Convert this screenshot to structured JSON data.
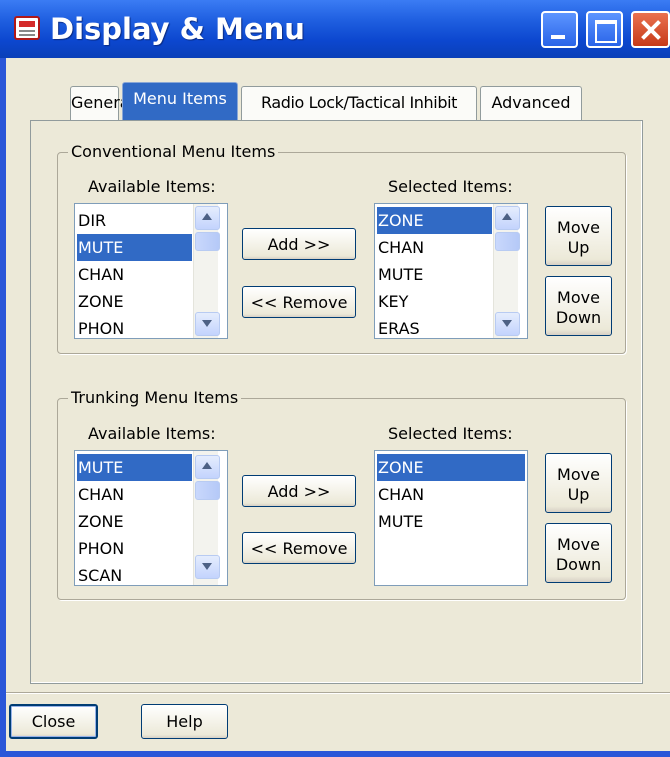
{
  "window": {
    "title": "Display & Menu"
  },
  "tabs": [
    "General",
    "Menu Items",
    "Radio Lock/Tactical Inhibit",
    "Advanced"
  ],
  "active_tab": "Menu Items",
  "conventional": {
    "group_label": "Conventional Menu Items",
    "available_label": "Available Items:",
    "selected_label": "Selected Items:",
    "available_items": [
      "DIR",
      "MUTE",
      "CHAN",
      "ZONE",
      "PHON"
    ],
    "available_selected": "MUTE",
    "selected_items": [
      "ZONE",
      "CHAN",
      "MUTE",
      "KEY",
      "ERAS"
    ],
    "selected_selected": "ZONE",
    "add_label": "Add >>",
    "remove_label": "<< Remove",
    "move_up": [
      "Move",
      "Up"
    ],
    "move_down": [
      "Move",
      "Down"
    ]
  },
  "trunking": {
    "group_label": "Trunking Menu Items",
    "available_label": "Available Items:",
    "selected_label": "Selected Items:",
    "available_items": [
      "MUTE",
      "CHAN",
      "ZONE",
      "PHON",
      "SCAN"
    ],
    "available_selected": "MUTE",
    "selected_items": [
      "ZONE",
      "CHAN",
      "MUTE"
    ],
    "selected_selected": "ZONE",
    "add_label": "Add >>",
    "remove_label": "<< Remove",
    "move_up": [
      "Move",
      "Up"
    ],
    "move_down": [
      "Move",
      "Down"
    ]
  },
  "footer": {
    "close_label": "Close",
    "help_label": "Help"
  },
  "colors": {
    "titlebar": "#0a47d0",
    "selection": "#316ac5",
    "dialog_bg": "#ece9d8"
  },
  "icons": {
    "title": "document-icon",
    "minimize": "minimize-icon",
    "maximize": "maximize-icon",
    "close": "close-icon"
  }
}
